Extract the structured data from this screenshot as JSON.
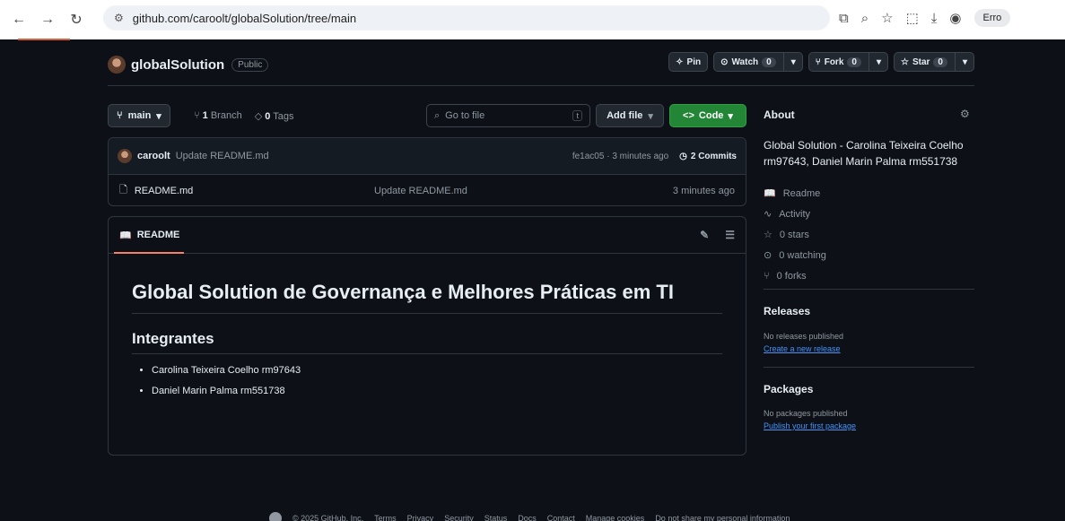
{
  "browser": {
    "url": "github.com/caroolt/globalSolution/tree/main",
    "profile_label": "Erro"
  },
  "repo": {
    "name": "globalSolution",
    "visibility": "Public",
    "pin_label": "Pin",
    "watch_label": "Watch",
    "watch_count": "0",
    "fork_label": "Fork",
    "fork_count": "0",
    "star_label": "Star",
    "star_count": "0"
  },
  "branch": {
    "current": "main",
    "branch_count": "1",
    "branch_label": "Branch",
    "tag_count": "0",
    "tag_label": "Tags",
    "goto_placeholder": "Go to file",
    "goto_shortcut": "t",
    "add_file_label": "Add file",
    "code_label": "Code"
  },
  "commit": {
    "author": "caroolt",
    "message": "Update README.md",
    "meta": "fe1ac05 · 3 minutes ago",
    "commits_label": "2 Commits"
  },
  "files": [
    {
      "name": "README.md",
      "message": "Update README.md",
      "age": "3 minutes ago"
    }
  ],
  "readme": {
    "tab_label": "README",
    "h1": "Global Solution de Governança e Melhores Práticas em TI",
    "h2": "Integrantes",
    "members": [
      "Carolina Teixeira Coelho rm97643",
      "Daniel Marin Palma rm551738"
    ]
  },
  "about": {
    "title": "About",
    "description": "Global Solution - Carolina Teixeira Coelho rm97643, Daniel Marin Palma rm551738",
    "links": [
      {
        "icon": "book-icon",
        "label": "Readme"
      },
      {
        "icon": "pulse-icon",
        "label": "Activity"
      },
      {
        "icon": "star-icon",
        "label": "0 stars"
      },
      {
        "icon": "eye-icon",
        "label": "0 watching"
      },
      {
        "icon": "fork-icon",
        "label": "0 forks"
      }
    ]
  },
  "releases": {
    "title": "Releases",
    "empty": "No releases published",
    "link": "Create a new release"
  },
  "packages": {
    "title": "Packages",
    "empty": "No packages published",
    "link": "Publish your first package"
  },
  "footer": {
    "copyright": "© 2025 GitHub, Inc.",
    "links": [
      "Terms",
      "Privacy",
      "Security",
      "Status",
      "Docs",
      "Contact",
      "Manage cookies",
      "Do not share my personal information"
    ]
  },
  "colors": {
    "background": "#0d1117",
    "code_button": "#238636",
    "link": "#4493f8",
    "tab_underline": "#f78166"
  }
}
